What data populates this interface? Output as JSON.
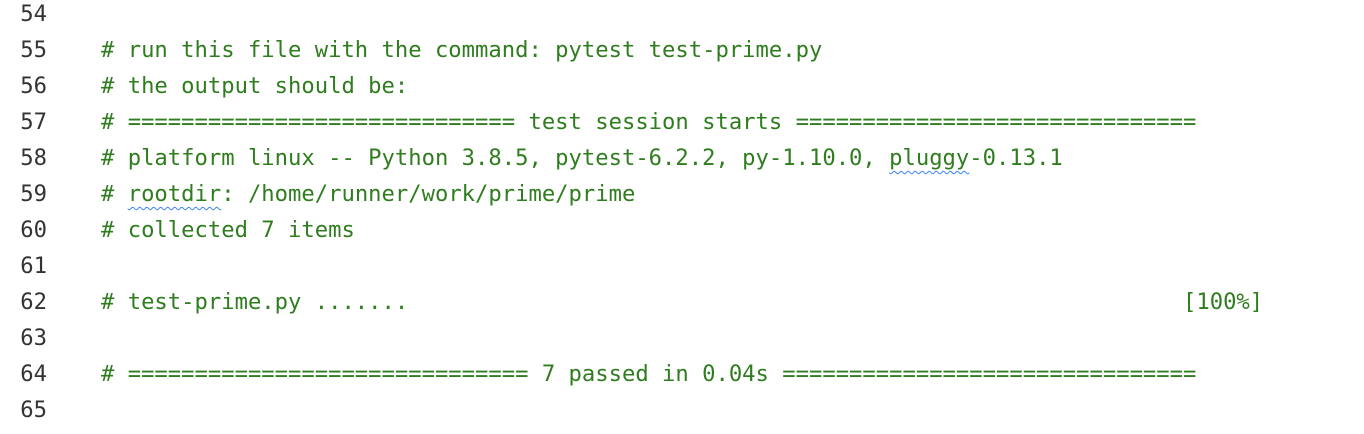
{
  "colors": {
    "comment": "#2f7d1f",
    "line_number": "#333333",
    "spell_squiggle": "#3b82f6",
    "background": "#ffffff"
  },
  "lines": [
    {
      "number": "54",
      "text": ""
    },
    {
      "number": "55",
      "text": "# run this file with the command: pytest test-prime.py"
    },
    {
      "number": "56",
      "text": "# the output should be:"
    },
    {
      "number": "57",
      "text": "# ============================= test session starts =============================="
    },
    {
      "number": "58",
      "prefix": "# platform linux -- Python 3.8.5, pytest-6.2.2, py-1.10.0, ",
      "flagged": "pluggy",
      "suffix": "-0.13.1"
    },
    {
      "number": "59",
      "prefix": "# ",
      "flagged": "rootdir",
      "suffix": ": /home/runner/work/prime/prime"
    },
    {
      "number": "60",
      "text": "# collected 7 items"
    },
    {
      "number": "61",
      "text": ""
    },
    {
      "number": "62",
      "text": "# test-prime.py .......                                                          [100%]"
    },
    {
      "number": "63",
      "text": ""
    },
    {
      "number": "64",
      "text": "# ============================== 7 passed in 0.04s ==============================="
    },
    {
      "number": "65",
      "text": ""
    }
  ]
}
